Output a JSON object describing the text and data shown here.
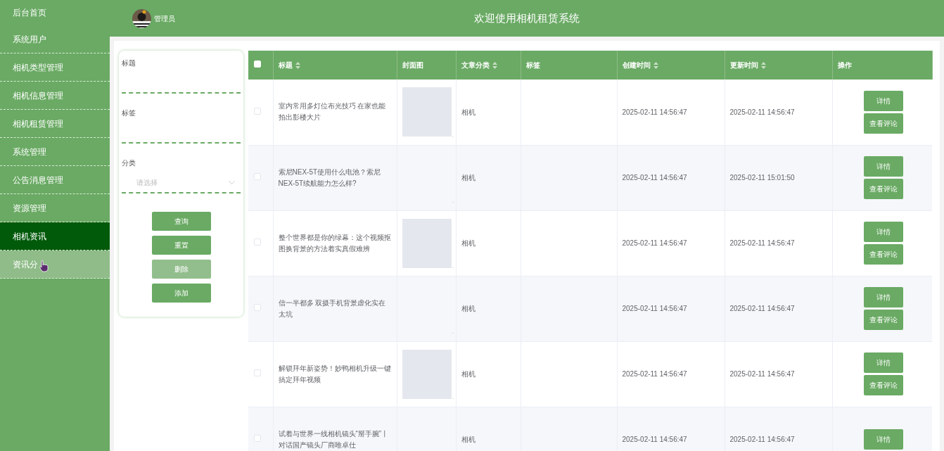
{
  "sidebar": {
    "items": [
      {
        "label": "后台首页",
        "selected": false,
        "hovered": false
      },
      {
        "label": "系统用户",
        "selected": false,
        "hovered": false
      },
      {
        "label": "相机类型管理",
        "selected": false,
        "hovered": false
      },
      {
        "label": "相机信息管理",
        "selected": false,
        "hovered": false
      },
      {
        "label": "相机租赁管理",
        "selected": false,
        "hovered": false
      },
      {
        "label": "系统管理",
        "selected": false,
        "hovered": false
      },
      {
        "label": "公告消息管理",
        "selected": false,
        "hovered": false
      },
      {
        "label": "资源管理",
        "selected": false,
        "hovered": false
      },
      {
        "label": "相机资讯",
        "selected": true,
        "hovered": false
      },
      {
        "label": "资讯分",
        "selected": false,
        "hovered": true
      }
    ]
  },
  "header": {
    "user": "管理员",
    "title": "欢迎使用相机租赁系统"
  },
  "search": {
    "fields": [
      {
        "kind": "text",
        "label": "标题"
      },
      {
        "kind": "text",
        "label": "标签"
      },
      {
        "kind": "select",
        "label": "分类",
        "placeholder": "请选择"
      }
    ],
    "buttons": [
      {
        "label": "查询",
        "disabled": false
      },
      {
        "label": "重置",
        "disabled": false
      },
      {
        "label": "删除",
        "disabled": true
      },
      {
        "label": "添加",
        "disabled": false
      }
    ]
  },
  "table": {
    "select_all_checked": false,
    "columns": [
      {
        "label": "标题",
        "sortable": true
      },
      {
        "label": "封面图",
        "sortable": false
      },
      {
        "label": "文章分类",
        "sortable": true
      },
      {
        "label": "标签",
        "sortable": false
      },
      {
        "label": "创建时间",
        "sortable": true
      },
      {
        "label": "更新时间",
        "sortable": true
      },
      {
        "label": "操作",
        "sortable": false
      }
    ],
    "rows": [
      {
        "checked": false,
        "title": "室内常用多灯位布光技巧 在家也能拍出影楼大片",
        "cover_image": true,
        "cover_mark": "..",
        "category": "相机",
        "created": "2025-02-11 14:56:47",
        "updated": "2025-02-11 14:56:47",
        "actions": [
          "详情",
          "查看评论"
        ]
      },
      {
        "checked": false,
        "title": "索尼NEX-5T使用什么电池？索尼NEX-5T续航能力怎么样?",
        "cover_image": false,
        "cover_mark": "..",
        "category": "相机",
        "created": "2025-02-11 14:56:47",
        "updated": "2025-02-11 15:01:50",
        "actions": [
          "详情",
          "查看评论"
        ]
      },
      {
        "checked": false,
        "title": "整个世界都是你的绿幕：这个视频抠图换背景的方法着实真假难辨",
        "cover_image": true,
        "cover_mark": "..",
        "category": "相机",
        "created": "2025-02-11 14:56:47",
        "updated": "2025-02-11 14:56:47",
        "actions": [
          "详情",
          "查看评论"
        ]
      },
      {
        "checked": false,
        "title": "信一半都多 双摄手机背景虚化实在太坑",
        "cover_image": false,
        "cover_mark": "..",
        "category": "相机",
        "created": "2025-02-11 14:56:47",
        "updated": "2025-02-11 14:56:47",
        "actions": [
          "详情",
          "查看评论"
        ]
      },
      {
        "checked": false,
        "title": "解锁拜年新姿势！妙鸭相机升级一键搞定拜年视频",
        "cover_image": true,
        "cover_mark": "..",
        "category": "相机",
        "created": "2025-02-11 14:56:47",
        "updated": "2025-02-11 14:56:47",
        "actions": [
          "详情",
          "查看评论"
        ]
      },
      {
        "checked": false,
        "title": "试着与世界一线相机镜头“掰手腕”丨对话国产镜头厂商唯卓仕",
        "cover_image": false,
        "category": "相机",
        "created": "2025-02-11 14:56:47",
        "updated": "2025-02-11 14:56:47",
        "actions": [
          "详情"
        ]
      }
    ]
  }
}
